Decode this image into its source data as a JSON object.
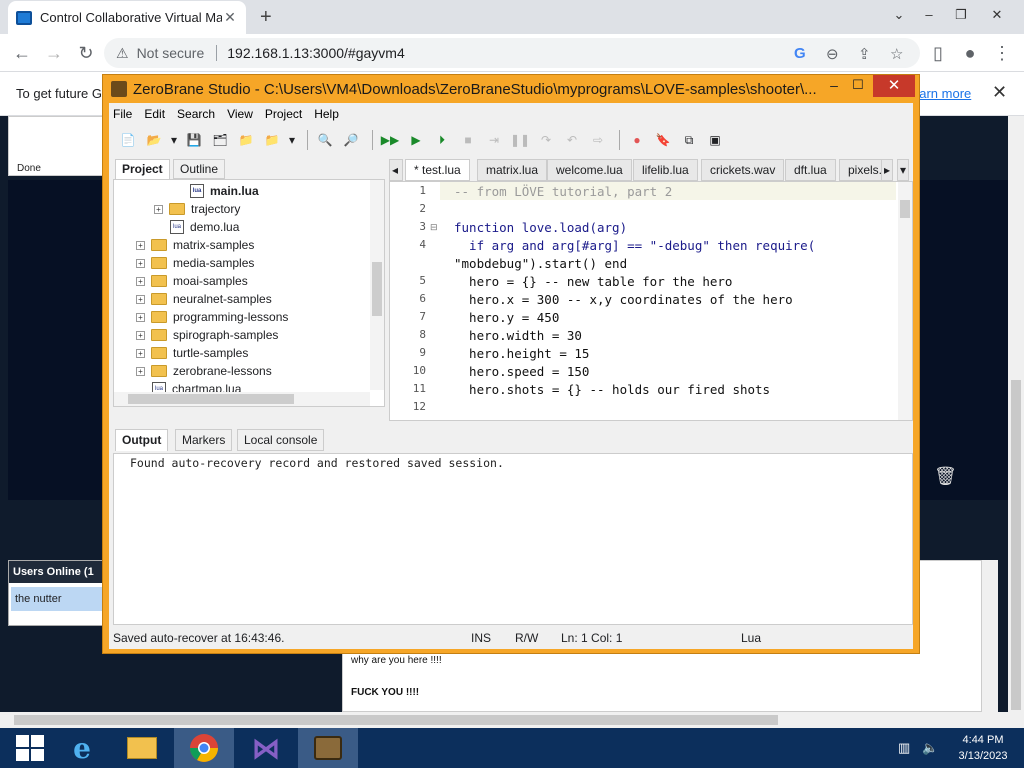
{
  "browser": {
    "tab_title": "Control Collaborative Virtual Ma",
    "new_tab": "+",
    "not_secure": "Not secure",
    "url": "192.168.1.13:3000/#gayvm4",
    "info_text": "To get future G",
    "learn_more": "earn more"
  },
  "page": {
    "done": "Done",
    "users_header": "Users Online (1",
    "users": [
      "the nutter"
    ],
    "chat": [
      "why are you here !!!!",
      "FUCK YOU !!!!"
    ]
  },
  "zb": {
    "title": "ZeroBrane Studio - C:\\Users\\VM4\\Downloads\\ZeroBraneStudio\\myprograms\\LOVE-samples\\shooter\\...",
    "menu": [
      "File",
      "Edit",
      "Search",
      "View",
      "Project",
      "Help"
    ],
    "panel_tabs": [
      "Project",
      "Outline"
    ],
    "tree": [
      {
        "label": "main.lua",
        "type": "file",
        "bold": true
      },
      {
        "label": "trajectory",
        "type": "folder"
      },
      {
        "label": "demo.lua",
        "type": "file"
      },
      {
        "label": "matrix-samples",
        "type": "folder"
      },
      {
        "label": "media-samples",
        "type": "folder"
      },
      {
        "label": "moai-samples",
        "type": "folder"
      },
      {
        "label": "neuralnet-samples",
        "type": "folder"
      },
      {
        "label": "programming-lessons",
        "type": "folder"
      },
      {
        "label": "spirograph-samples",
        "type": "folder"
      },
      {
        "label": "turtle-samples",
        "type": "folder"
      },
      {
        "label": "zerobrane-lessons",
        "type": "folder"
      },
      {
        "label": "chartmap.lua",
        "type": "file"
      }
    ],
    "editor_tabs": [
      "* test.lua",
      "matrix.lua",
      "welcome.lua",
      "lifelib.lua",
      "crickets.wav",
      "dft.lua",
      "pixels."
    ],
    "line_numbers": [
      "1",
      "2",
      "3",
      "4",
      "",
      "5",
      "6",
      "7",
      "8",
      "9",
      "10",
      "11",
      "12"
    ],
    "code": [
      "-- from LÖVE tutorial, part 2",
      "",
      "function love.load(arg)",
      "  if arg and arg[#arg] == \"-debug\" then require(",
      "\"mobdebug\").start() end",
      "  hero = {} -- new table for the hero",
      "  hero.x = 300 -- x,y coordinates of the hero",
      "  hero.y = 450",
      "  hero.width = 30",
      "  hero.height = 15",
      "  hero.speed = 150",
      "  hero.shots = {} -- holds our fired shots",
      ""
    ],
    "output_tabs": [
      "Output",
      "Markers",
      "Local console"
    ],
    "output_text": "Found auto-recovery record and restored saved session.",
    "status": {
      "left": "Saved auto-recover at 16:43:46.",
      "ins": "INS",
      "rw": "R/W",
      "pos": "Ln: 1 Col: 1",
      "lang": "Lua"
    }
  },
  "taskbar": {
    "time": "4:44 PM",
    "date": "3/13/2023"
  }
}
